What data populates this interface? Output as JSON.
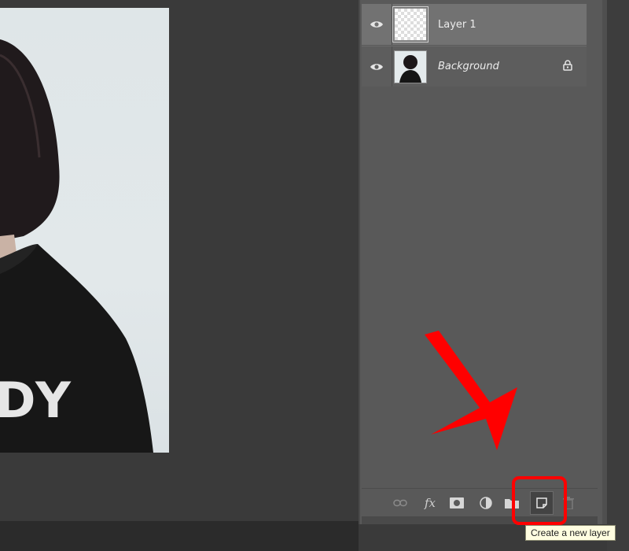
{
  "layers_panel": {
    "layers": [
      {
        "name": "Layer 1",
        "visible": true,
        "locked": false,
        "selected": true
      },
      {
        "name": "Background",
        "visible": true,
        "locked": true,
        "selected": false
      }
    ]
  },
  "toolbar": {
    "fx_label": "fx",
    "icons": [
      "link-layers-icon",
      "fx-icon",
      "add-mask-icon",
      "adjustment-layer-icon",
      "group-folder-icon",
      "new-layer-icon",
      "trash-icon"
    ]
  },
  "tooltip": "Create a new layer",
  "canvas": {
    "shirt_text": "DY"
  },
  "colors": {
    "highlight": "#ff0000",
    "panel_bg": "#595959",
    "selected_row": "#727272",
    "canvas_bg": "#3a3a3a"
  }
}
